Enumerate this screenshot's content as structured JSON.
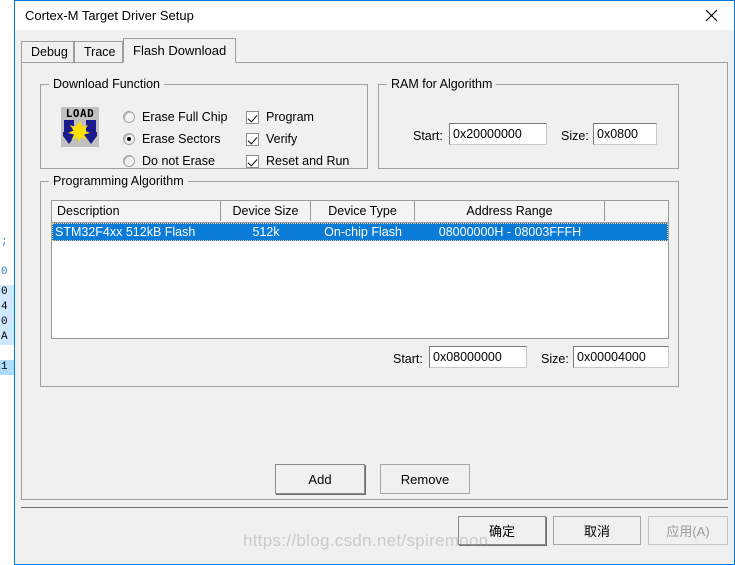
{
  "window": {
    "title": "Cortex-M Target Driver Setup",
    "close_icon": "close-icon",
    "accent_color": "#0078d7",
    "background_color": "#f0f0f0"
  },
  "tabs": [
    {
      "label": "Debug",
      "active": false
    },
    {
      "label": "Trace",
      "active": false
    },
    {
      "label": "Flash Download",
      "active": true
    }
  ],
  "download_function": {
    "title": "Download Function",
    "icon": "load-icon",
    "icon_text": "LOAD",
    "radios": [
      {
        "label": "Erase Full Chip",
        "selected": false
      },
      {
        "label": "Erase Sectors",
        "selected": true
      },
      {
        "label": "Do not Erase",
        "selected": false
      }
    ],
    "checkboxes": [
      {
        "label": "Program",
        "checked": true
      },
      {
        "label": "Verify",
        "checked": true
      },
      {
        "label": "Reset and Run",
        "checked": true
      }
    ]
  },
  "ram_for_algorithm": {
    "title": "RAM for Algorithm",
    "start_label": "Start:",
    "start_value": "0x20000000",
    "size_label": "Size:",
    "size_value": "0x0800"
  },
  "programming_algorithm": {
    "title": "Programming Algorithm",
    "columns": [
      "Description",
      "Device Size",
      "Device Type",
      "Address Range",
      ""
    ],
    "rows": [
      {
        "description": "STM32F4xx 512kB Flash",
        "device_size": "512k",
        "device_type": "On-chip Flash",
        "address_range": "08000000H - 08003FFFH",
        "selected": true
      }
    ],
    "start_label": "Start:",
    "start_value": "0x08000000",
    "size_label": "Size:",
    "size_value": "0x00004000",
    "selection_color": "#0a7bd7"
  },
  "actions": {
    "add_label": "Add",
    "remove_label": "Remove"
  },
  "footer": {
    "ok_label": "确定",
    "cancel_label": "取消",
    "apply_label": "应用(A)",
    "apply_enabled": false
  },
  "watermark": "https://blog.csdn.net/spiremoon",
  "background_editor": {
    "lines": [
      {
        "text": ";",
        "state": "plain"
      },
      {
        "text": "0",
        "state": "plain"
      },
      {
        "text": "0",
        "state": "sel"
      },
      {
        "text": "4",
        "state": "sel"
      },
      {
        "text": "0",
        "state": "sel"
      },
      {
        "text": "A",
        "state": "sel"
      },
      {
        "text": "1",
        "state": "hl"
      }
    ]
  }
}
